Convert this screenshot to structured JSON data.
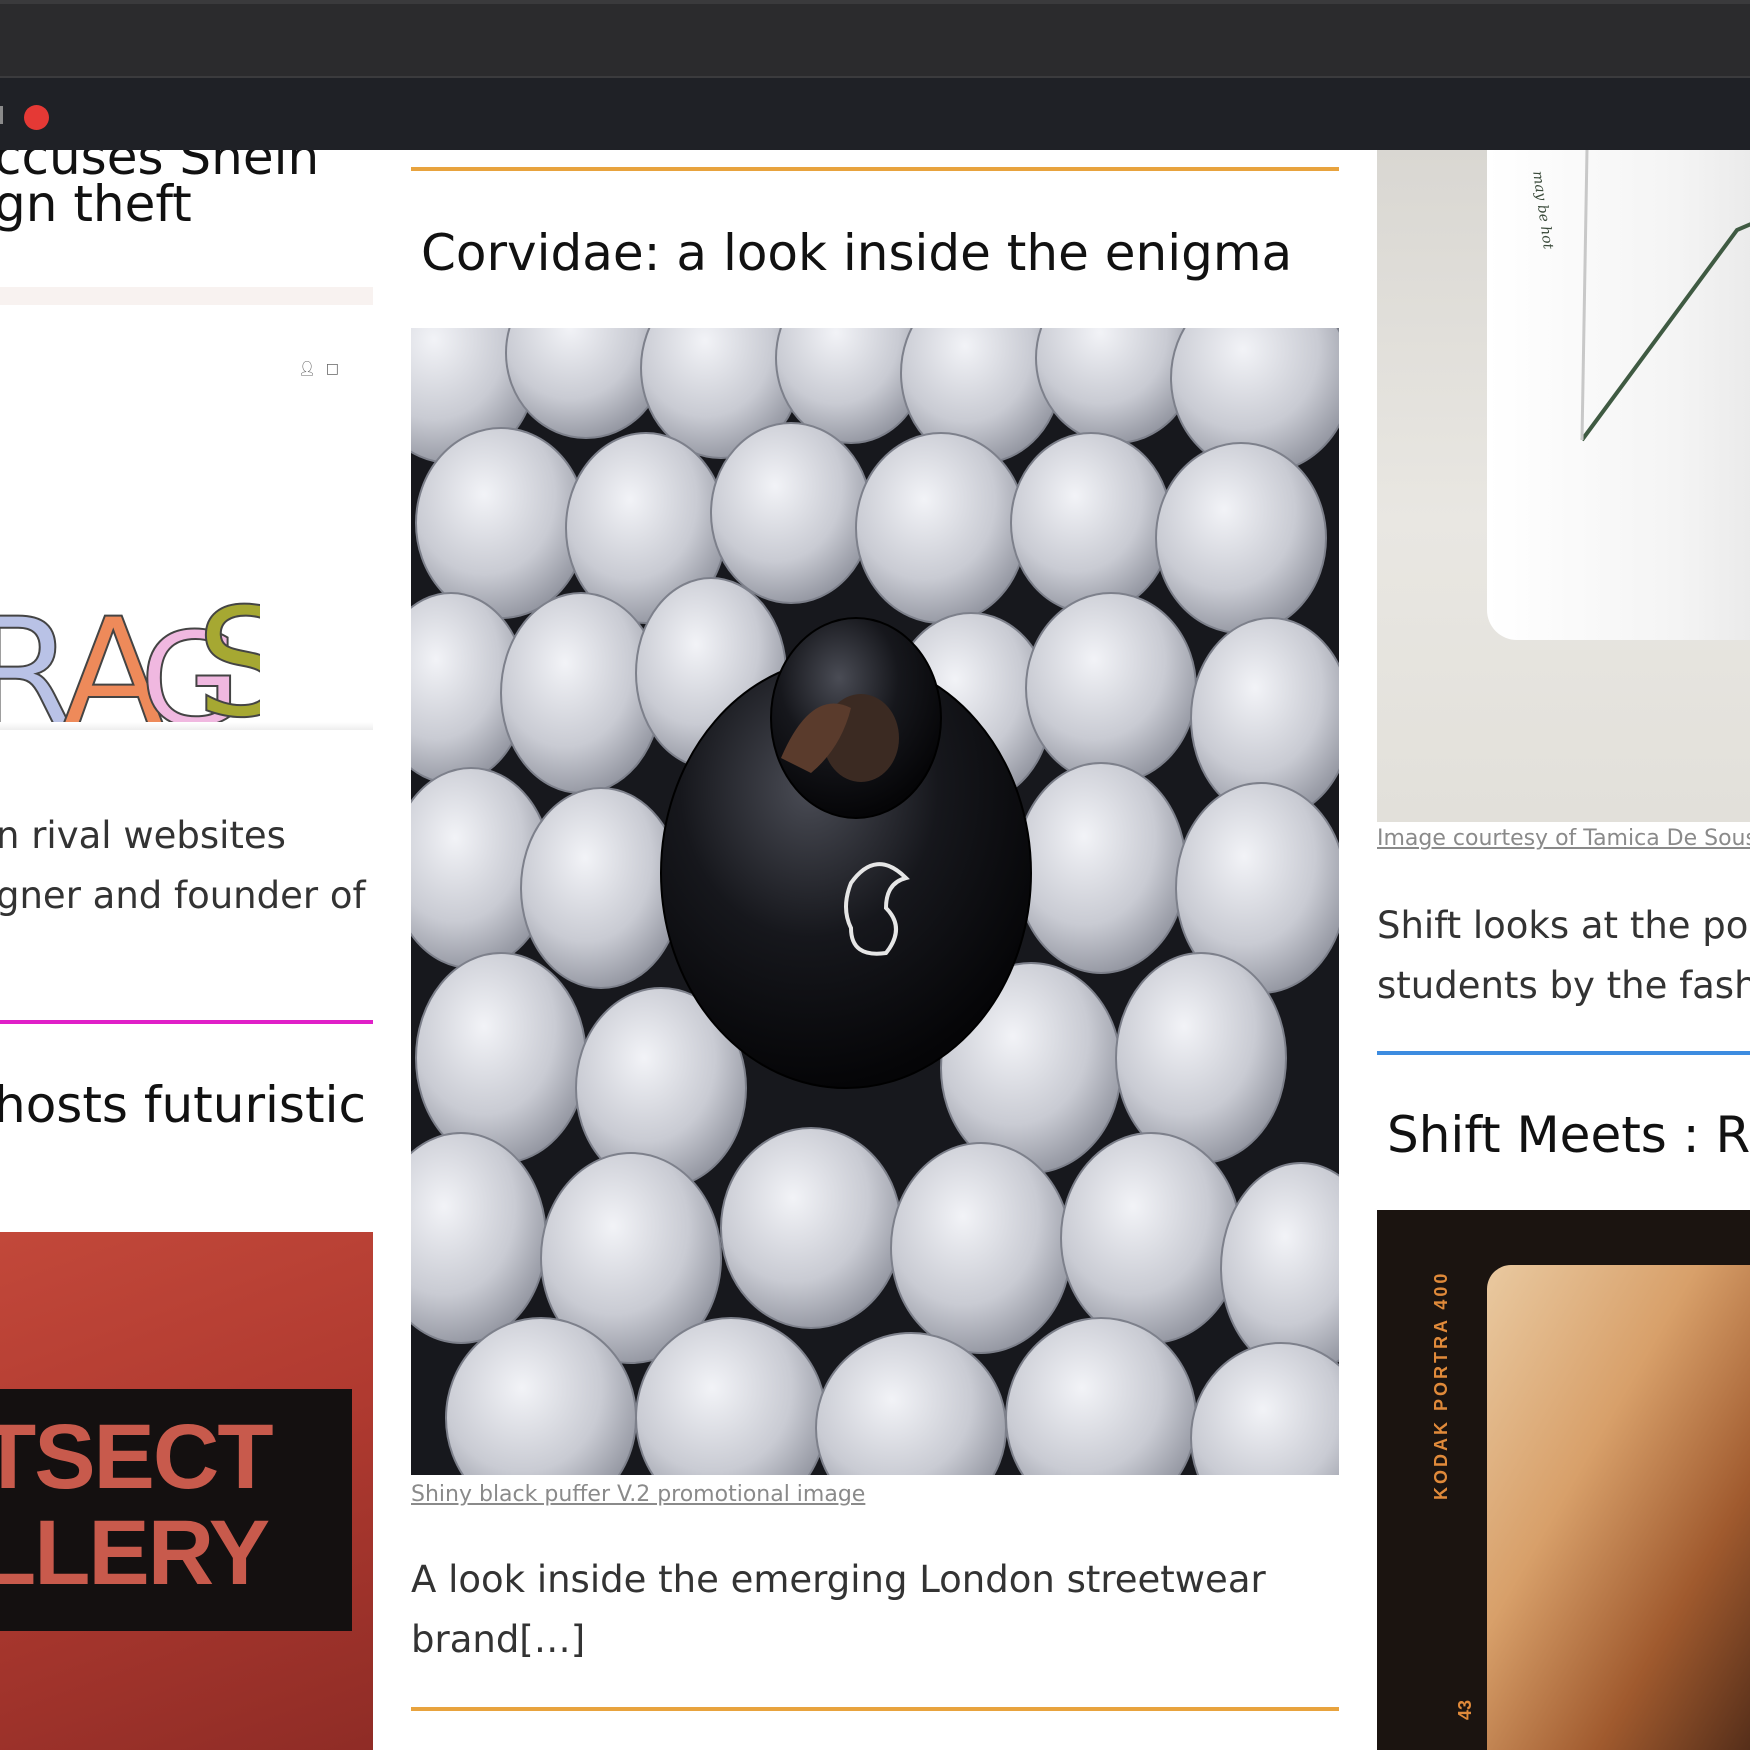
{
  "window": {
    "record_indicator_color": "#e53935"
  },
  "left": {
    "title_lines": [
      "ccuses Shein",
      "gn theft"
    ],
    "screenshot": {
      "icons": [
        "user-icon",
        "bag-icon"
      ],
      "logo_text": "RAGS"
    },
    "excerpt_lines": [
      "n rival websites",
      "gner and founder of"
    ],
    "rule_color": "#e020c8",
    "title2": "hosts futuristic",
    "photo_sign_lines": [
      "TSECT",
      "LLERY"
    ]
  },
  "middle": {
    "rule_color": "#e8a33e",
    "title": "Corvidae: a look inside the enigma",
    "photo_alt": "Person in a shiny black puffer jacket surrounded by figures in white puffer jackets",
    "caption": "Shiny black puffer V.2 promotional image",
    "excerpt": "A look inside the emerging London streetwear brand[…]"
  },
  "right": {
    "cup_text": "may be hot",
    "caption": "Image courtesy of Tamica De Sousa",
    "excerpt_lines": [
      "Shift looks at the po",
      "students by the fash"
    ],
    "rule_color": "#3d8ce0",
    "title": "Shift Meets : Ru",
    "film_label": "KODAK PORTRA 400",
    "film_number": "43"
  }
}
